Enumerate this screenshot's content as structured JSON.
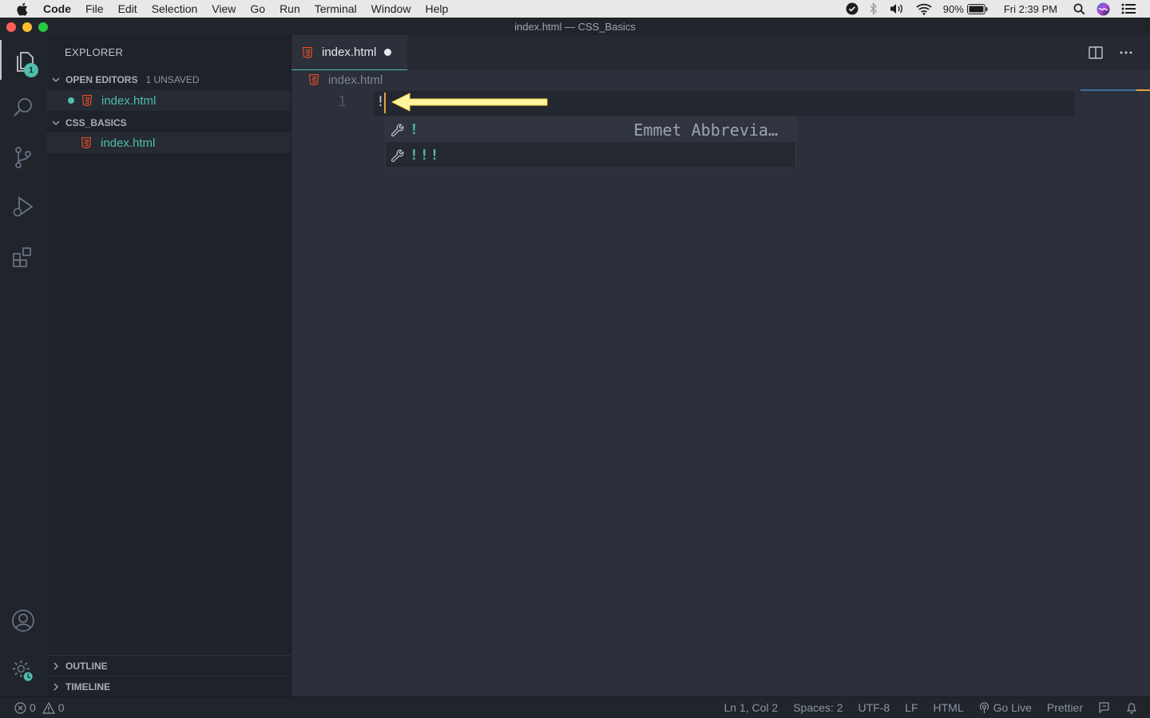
{
  "menubar": {
    "app": "Code",
    "items": [
      "File",
      "Edit",
      "Selection",
      "View",
      "Go",
      "Run",
      "Terminal",
      "Window",
      "Help"
    ],
    "battery": "90%",
    "clock": "Fri 2:39 PM"
  },
  "window": {
    "title": "index.html — CSS_Basics"
  },
  "activity": {
    "explorer_badge": "1"
  },
  "sidebar": {
    "title": "EXPLORER",
    "open_editors": {
      "label": "OPEN EDITORS",
      "extra": "1 UNSAVED",
      "file": "index.html"
    },
    "folder": {
      "label": "CSS_BASICS",
      "file": "index.html"
    },
    "outline": "OUTLINE",
    "timeline": "TIMELINE"
  },
  "editor": {
    "tab_label": "index.html",
    "breadcrumb": "index.html",
    "line_number": "1",
    "code": "!",
    "suggestions": [
      {
        "label": "!",
        "detail": "Emmet Abbrevia…"
      },
      {
        "label": "!!!",
        "detail": ""
      }
    ]
  },
  "status": {
    "errors": "0",
    "warnings": "0",
    "position": "Ln 1, Col 2",
    "spaces": "Spaces: 2",
    "encoding": "UTF-8",
    "eol": "LF",
    "language": "HTML",
    "golive": "Go Live",
    "prettier": "Prettier"
  },
  "colors": {
    "accent": "#4ebdaa",
    "html_icon": "#e44d26",
    "arrow": "#fff59d"
  }
}
